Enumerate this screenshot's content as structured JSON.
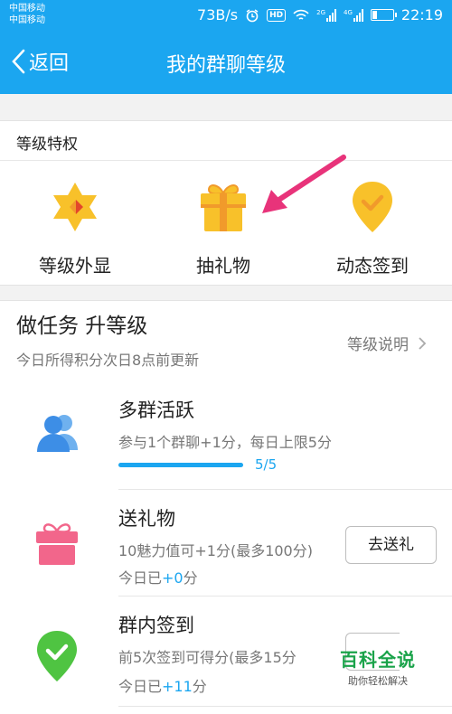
{
  "statusbar": {
    "carrier1": "中国移动",
    "carrier2": "中国移动",
    "speed": "73B/s",
    "hd": "HD",
    "net1": "2G",
    "net2": "4G",
    "time": "22:19"
  },
  "navbar": {
    "back_label": "返回",
    "title": "我的群聊等级"
  },
  "privileges": {
    "header": "等级特权",
    "items": [
      {
        "label": "等级外显",
        "icon": "star-badge-icon",
        "color": "#f8c12a"
      },
      {
        "label": "抽礼物",
        "icon": "gift-icon",
        "color": "#f8c12a"
      },
      {
        "label": "动态签到",
        "icon": "location-check-icon",
        "color": "#f8c12a"
      }
    ]
  },
  "tasks_header": {
    "title": "做任务 升等级",
    "subtitle": "今日所得积分次日8点前更新",
    "link_label": "等级说明"
  },
  "tasks": [
    {
      "name": "多群活跃",
      "desc": "参与1个群聊+1分，每日上限5分",
      "progress_text": "5/5",
      "progress": 1.0,
      "icon": "users-icon",
      "color": "#3d8ee6"
    },
    {
      "name": "送礼物",
      "desc": "10魅力值可+1分(最多100分)",
      "today_prefix": "今日已",
      "today_value": "+0",
      "today_suffix": "分",
      "button": "去送礼",
      "icon": "gift-icon",
      "color": "#f2668b"
    },
    {
      "name": "群内签到",
      "desc": "前5次签到可得分(最多15分",
      "today_prefix": "今日已",
      "today_value": "+11",
      "today_suffix": "分",
      "icon": "location-check-icon",
      "color": "#4fc442"
    }
  ],
  "watermark": {
    "main": "百科全说",
    "sub": "助你轻松解决"
  },
  "colors": {
    "accent": "#1ba6f0",
    "annotation_arrow": "#e8337a"
  }
}
